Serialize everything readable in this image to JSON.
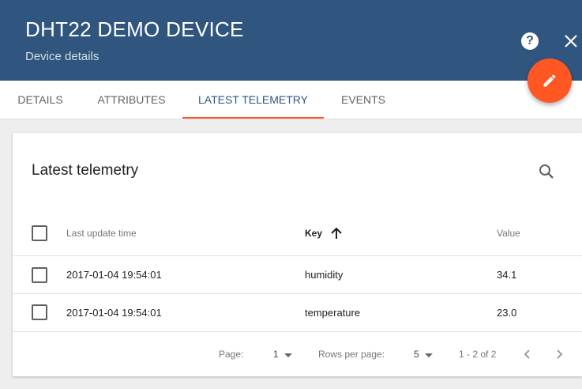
{
  "header": {
    "title": "DHT22 DEMO DEVICE",
    "subtitle": "Device details",
    "help_icon": "help-circle-icon",
    "close_icon": "close-icon",
    "bg_color": "#305680"
  },
  "fab": {
    "icon": "pencil-icon",
    "color": "#ff5722"
  },
  "tabs": [
    {
      "label": "DETAILS"
    },
    {
      "label": "ATTRIBUTES"
    },
    {
      "label": "LATEST TELEMETRY",
      "active": true
    },
    {
      "label": "EVENTS"
    }
  ],
  "card": {
    "title": "Latest telemetry",
    "search_icon": "search-icon"
  },
  "table": {
    "columns": [
      "Last update time",
      "Key",
      "Value"
    ],
    "sort_column": "Key",
    "sort_direction": "ascending",
    "rows": [
      {
        "time": "2017-01-04 19:54:01",
        "key": "humidity",
        "value": "34.1"
      },
      {
        "time": "2017-01-04 19:54:01",
        "key": "temperature",
        "value": "23.0"
      }
    ]
  },
  "pagination": {
    "page_label": "Page:",
    "page_value": "1",
    "rows_label": "Rows per page:",
    "rows_value": "5",
    "range": "1 - 2 of 2"
  }
}
